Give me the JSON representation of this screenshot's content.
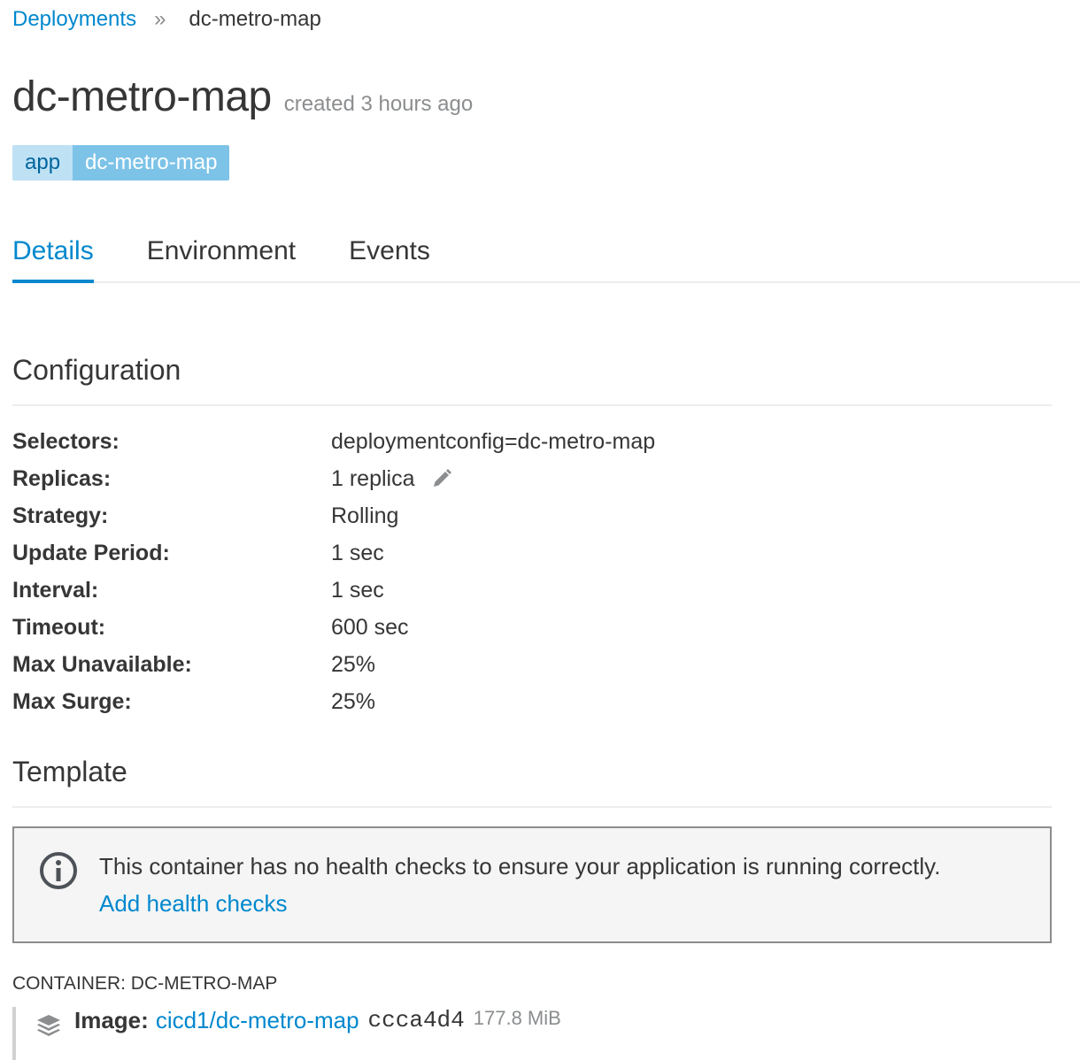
{
  "breadcrumb": {
    "parent": "Deployments",
    "separator": "»",
    "current": "dc-metro-map"
  },
  "header": {
    "title": "dc-metro-map",
    "created": "created 3 hours ago"
  },
  "label": {
    "key": "app",
    "value": "dc-metro-map"
  },
  "tabs": [
    {
      "label": "Details",
      "active": true
    },
    {
      "label": "Environment",
      "active": false
    },
    {
      "label": "Events",
      "active": false
    }
  ],
  "configuration": {
    "title": "Configuration",
    "rows": [
      {
        "key": "Selectors:",
        "value": "deploymentconfig=dc-metro-map"
      },
      {
        "key": "Replicas:",
        "value": "1 replica",
        "editable": true
      },
      {
        "key": "Strategy:",
        "value": "Rolling"
      },
      {
        "key": "Update Period:",
        "value": "1 sec"
      },
      {
        "key": "Interval:",
        "value": "1 sec"
      },
      {
        "key": "Timeout:",
        "value": "600 sec"
      },
      {
        "key": "Max Unavailable:",
        "value": "25%"
      },
      {
        "key": "Max Surge:",
        "value": "25%"
      }
    ]
  },
  "template": {
    "title": "Template",
    "alert": {
      "icon": "info-circle-icon",
      "message": "This container has no health checks to ensure your application is running correctly.",
      "link": "Add health checks"
    },
    "container": {
      "heading": "CONTAINER: DC-METRO-MAP",
      "image_label": "Image:",
      "image_link": "cicd1/dc-metro-map",
      "image_hash": "ccca4d4",
      "image_size": "177.8 MiB"
    }
  },
  "colors": {
    "link": "#0088ce",
    "label_key_bg": "#bee1f4",
    "label_value_bg": "#7dc3e8",
    "alert_bg": "#f5f5f5"
  }
}
